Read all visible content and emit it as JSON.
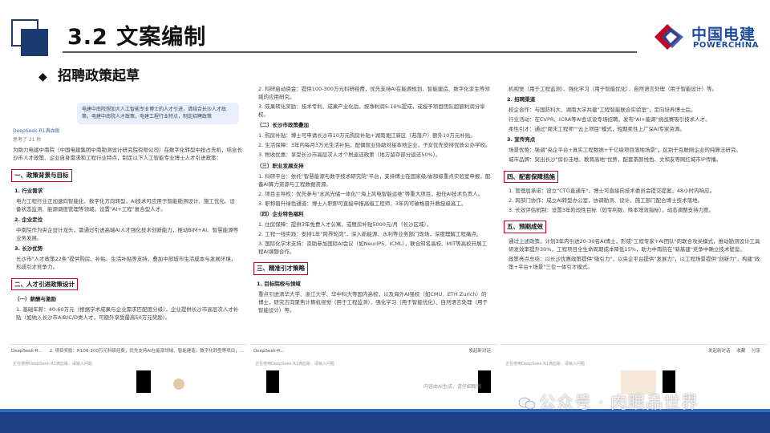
{
  "header": {
    "title": "3.2 文案编制",
    "subtitle": "招聘政策起草",
    "brand_cn": "中国电建",
    "brand_en": "POWERCHINA"
  },
  "colors": {
    "navy": "#1b3a6e",
    "brand": "#1e4b9a",
    "highlight": "#c9001f",
    "footer": "#1d3f86"
  },
  "panel1": {
    "prompt": "电建中南院想加大人工智能专业博士的人才引进，请结合长沙人才政策，电建中南院人才政策，电建工程行业特点，制定招聘政策",
    "model": "DeepSeek-R1满血版",
    "thinking": "思考了 21 秒",
    "intro": "为助力电建中南院（中国电建集团中南勘测设计研究院有限公司）在数字化转型中抢占先机，结合长沙市人才政策、企业自身需求和工程行业特点，制定以下人工智能专业博士人才引进政策：",
    "sec1": "一、政策背景与目标",
    "items": [
      "1. 行业需求",
      "电力工程行业正加速向智能化、数字化方向转型，AI技术可应用于智能勘测设计、施工优化、设备状态监测、能源调度管理等领域。设置\"AI+工程\"复合型人才。",
      "2. 企业定位",
      "中南院作为央企设计龙头，需通过引进高端AI人才强化技术创新能力，推动BIM+AI、智慧能源等业务发展。",
      "3. 长沙优势",
      "长沙市\"人才政策22条\"提供购房、补贴、生活补贴等支持，叠加中部城市生活成本与发展环境，形成引才竞争力。"
    ],
    "sec2": "二、人才引进政策设计",
    "sub2": "（一）薪酬与激励",
    "item2": "1. 基础年薪：40-60万元（根据学术成果与企业需求匹配度分级），企业提供长沙市高层次人才补贴（如纳入长沙市A/B/C/D类人才，可额外享受最高50万元奖励）。",
    "tail": "2. 项目奖励：R100-300万元科研经费，优先支持AI在能源领域、智能建造、数字化转型等项目，..."
  },
  "panel2": {
    "lines": [
      "2. 科研启动资金：提供100-300万元科研经费，优先支持AI在能源规划、智能建造、数字化孪生等领域的应用研究。",
      "3. 成果转化奖励：技术专利、成果产业化后，按净利润5-10%提成，或授予项目团队超额利润分享权。"
    ],
    "sub_a": "（二）长沙市政策叠加",
    "a_items": [
      "1. 购房补贴：博士可申请长沙市10万元购房补贴+湖南湘江新区（若落户）额外10万元补贴。",
      "2. 生活保障：3年内每月3万元生活补贴，配偶就业协助对接本地企业，子女优先安排优质公办学校。",
      "3. 税收优惠：享受长沙市高层次人才个税返还政策（地方留存部分返还50%）。"
    ],
    "sub_b": "（三）职业发展支持",
    "b_items": [
      "1. 科研平台：依托\"智慧能源与数字技术研究院\"平台，支持博士在国家级/省部级重点实验室申报，配备AI算力资源与工程数据资源。",
      "2. 项目主导权：优先参与\"水风光储一体化\"\"海上风电智能运维\"等重大项目，担任AI技术负责人。",
      "3. 职称晋升绿色通道：博士入职即可直接申报高级工程师，3年内可破格晋升教授级高工。"
    ],
    "sub_c": "（四）企业特色福利",
    "c_items": [
      "1. 住房保障：提供3年免费人才公寓，或租房补贴5000元/月（长沙区域）。",
      "2. 工程一线实践：安排1年\"跨界轮岗\"，深入新能源、水利等业务部门现场，深度理解工程痛点。",
      "3. 国际化学术支持：资助参加国际AI会议（如NeurIPS、ICML），联合知名高校、MIT等高校开展工程AI课题合作。"
    ],
    "sec3": "三、精准引才策略",
    "sub_d": "1. 目标院校与领域",
    "d_text": "重点引进清华大学、浙江大学、华中科大等国内高校，以及海外AI强校（如CMU、ETH Zurich）的博士，研究方向聚焦计算机视觉（用于工程监测）、强化学习（用于智能优化）、自然语言处理（用于智能设计）等。",
    "bar_left": "DeepSeek-R...",
    "bar_right": "发起新对话"
  },
  "panel3": {
    "lead": "机视觉（用于工程监测）、强化学习（用于智能优化）、自然语言处理（用于智能设计）等。",
    "sub_a": "2. 招聘渠道",
    "a_items": [
      "校企合作：与国防科大、湖南大学共建\"工程智能联合实验室\"，定向培养博士后。",
      "行业活动：在CVPR、ICRA等AI会议设专场招聘，发布\"AI+能源\"挑战赛吸引技术人才。",
      "柔性引才：通过\"周末工程师\"\"云上项目\"模式，短期柔性上广深AI专家资源。"
    ],
    "sub_b": "3. 宣传亮点",
    "b_items": [
      "场景优势：强调\"央企平台+真实工程数据+千亿级项目落地场景\"，区别于互联网企业的纯算法研究。",
      "城市品牌：突出长沙\"房价洼地、教育高地\"优势，配套茶颜悦色、文和友等网红城市IP传播。"
    ],
    "sec4": "四、配套保障措施",
    "c_items": [
      "1. 管理层承诺：设立\"CTO直通车\"，博士可直接向技术委员会提交提案，48小时内响应。",
      "2. 跨部门协作：成立AI转型办公室，协调勘测、设计、施工部门配合博士技术落地。",
      "3. 长效评估机制：设置3年阶段性目标（如专利数、降本增效指标），动态调整支持力度。"
    ],
    "sec5": "五、预期成效",
    "d_text": "通过上述政策，计划3年内引进20-30名AI博士，形成\"工程专家+AI团队\"的联合攻关模式，推动勘测设计工具研发效率提升30%，工程项目全生命周期成本降低15%，助力中南院在\"新基建\"竞争中确立技术壁垒。",
    "e_text": "政策亮点总结：以长沙优惠政策提供\"吸引力\"，以央企平台提供\"发展力\"，以工程场景提供\"创新力\"，构建\"政策+平台+场景\"三位一体引才模式。",
    "bar_right1": "发起新对话",
    "bar_right2": "收藏",
    "bar_right3": "分享"
  },
  "common": {
    "hint": "正在使用DeepSeek-R1满血版，请输入问题",
    "bottom_note": "内容由AI生成，请仔细甄别",
    "watermark": "公众号 · 肉眼品世界"
  }
}
